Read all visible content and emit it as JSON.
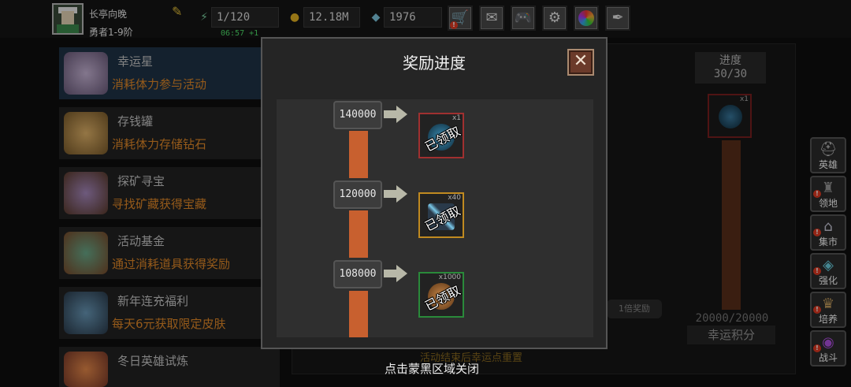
{
  "player": {
    "name": "长亭向晚",
    "rank": "勇者1-9阶"
  },
  "resources": {
    "stamina": "1/120",
    "stamina_timer": "06:57 +1",
    "gold": "12.18M",
    "diamonds": "1976"
  },
  "top_buttons": [
    "shop-cart-icon",
    "mail-icon",
    "gamepad-icon",
    "gear-icon",
    "color-wheel-icon",
    "feather-icon"
  ],
  "activities": [
    {
      "title": "幸运星",
      "desc": "消耗体力参与活动",
      "icon": "lucky-star-icon",
      "color": "#8a7a9a"
    },
    {
      "title": "存钱罐",
      "desc": "消耗体力存储钻石",
      "icon": "piggy-bank-icon",
      "color": "#c99a55"
    },
    {
      "title": "探矿寻宝",
      "desc": "寻找矿藏获得宝藏",
      "icon": "treasure-chest-icon",
      "color": "#8a6aa0"
    },
    {
      "title": "活动基金",
      "desc": "通过消耗道具获得奖励",
      "icon": "fund-bag-icon",
      "color": "#4a8a6a"
    },
    {
      "title": "新年连充福利",
      "desc": "每天6元获取限定皮肤",
      "icon": "ice-skin-icon",
      "color": "#4a6a8a"
    },
    {
      "title": "冬日英雄试炼",
      "desc": "",
      "icon": "hero-trial-icon",
      "color": "#c8673a"
    }
  ],
  "background": {
    "progress_label": "进度",
    "progress_value": "30/30",
    "item_count": "x1",
    "score": "20000/20000",
    "score_label": "幸运积分",
    "x1_reward": "1倍奖励",
    "reset_note": "活动结束后幸运点重置"
  },
  "sidebar": [
    {
      "label": "英雄",
      "icon": "helmet-icon"
    },
    {
      "label": "领地",
      "icon": "castle-icon"
    },
    {
      "label": "集市",
      "icon": "market-stall-icon"
    },
    {
      "label": "强化",
      "icon": "crystal-icon"
    },
    {
      "label": "培养",
      "icon": "trophy-icon"
    },
    {
      "label": "战斗",
      "icon": "portal-icon"
    }
  ],
  "modal": {
    "title": "奖励进度",
    "milestones": [
      {
        "points": "140000",
        "count": "x1",
        "status": "已领取",
        "border": "#a03030",
        "item": "orb-item-icon",
        "item_color": "#1e4a6a"
      },
      {
        "points": "120000",
        "count": "x40",
        "status": "已领取",
        "border": "#c08a20",
        "item": "sword-item-icon",
        "item_color": "#3a5a6a"
      },
      {
        "points": "108000",
        "count": "x1000",
        "status": "已领取",
        "border": "#2a8a3a",
        "item": "coin-bag-item-icon",
        "item_color": "#8a5a2a"
      }
    ],
    "close_hint": "点击蒙黑区域关闭"
  },
  "colors": {
    "accent_orange": "#e58a28",
    "bar_fill": "#c8602f",
    "timer_green": "#4ee06a",
    "alert_red": "#e23a22"
  }
}
